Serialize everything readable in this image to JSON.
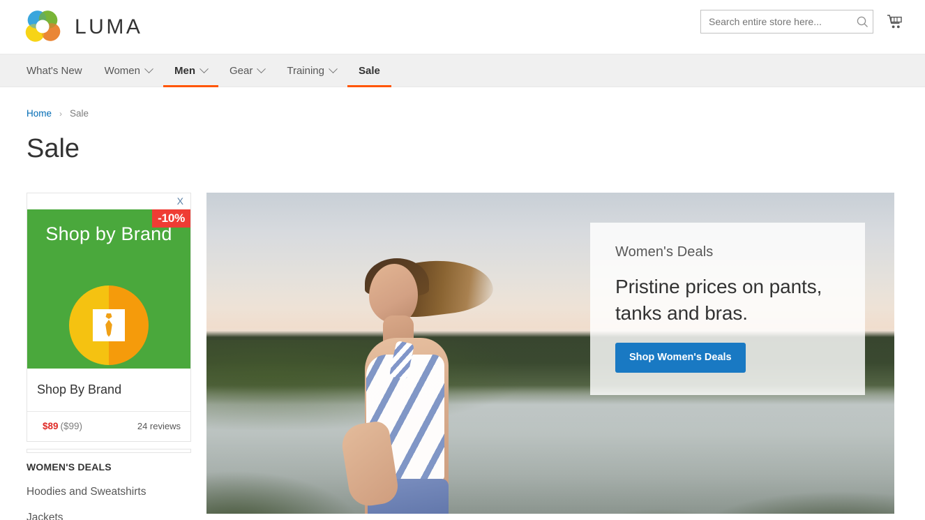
{
  "header": {
    "brand_name": "LUMA",
    "logo_icon": "luma-flower-logo",
    "search": {
      "placeholder": "Search entire store here...",
      "value": "",
      "icon": "search-icon"
    },
    "cart_icon": "shopping-cart-icon"
  },
  "nav": {
    "items": [
      {
        "label": "What's New",
        "has_caret": false,
        "active": false
      },
      {
        "label": "Women",
        "has_caret": true,
        "active": false
      },
      {
        "label": "Men",
        "has_caret": true,
        "active": true
      },
      {
        "label": "Gear",
        "has_caret": true,
        "active": false
      },
      {
        "label": "Training",
        "has_caret": true,
        "active": false
      },
      {
        "label": "Sale",
        "has_caret": false,
        "active": true
      }
    ],
    "accent_color": "#ff5501"
  },
  "breadcrumb": {
    "home": "Home",
    "separator": "›",
    "current": "Sale"
  },
  "page": {
    "title": "Sale"
  },
  "sidebar": {
    "promo_card": {
      "close_label": "X",
      "discount_badge": "-10%",
      "banner_text": "Shop by Brand",
      "banner_color": "#4aa83c",
      "badge_color": "#ef3c34",
      "circle_icon": "necktie-icon",
      "product_name": "Shop By Brand",
      "price_now": "$89",
      "price_old": "($99)",
      "price_now_color": "#e02b27",
      "reviews": "24 reviews"
    },
    "category_heading": "WOMEN'S DEALS",
    "category_links": [
      {
        "label": "Hoodies and Sweatshirts"
      },
      {
        "label": "Jackets"
      }
    ]
  },
  "hero": {
    "image_alt": "woman jogging by a lake at dusk",
    "panel": {
      "eyebrow": "Women's Deals",
      "headline": "Pristine prices on pants, tanks and bras.",
      "button_label": "Shop Women's Deals",
      "button_color": "#1979c3"
    }
  }
}
